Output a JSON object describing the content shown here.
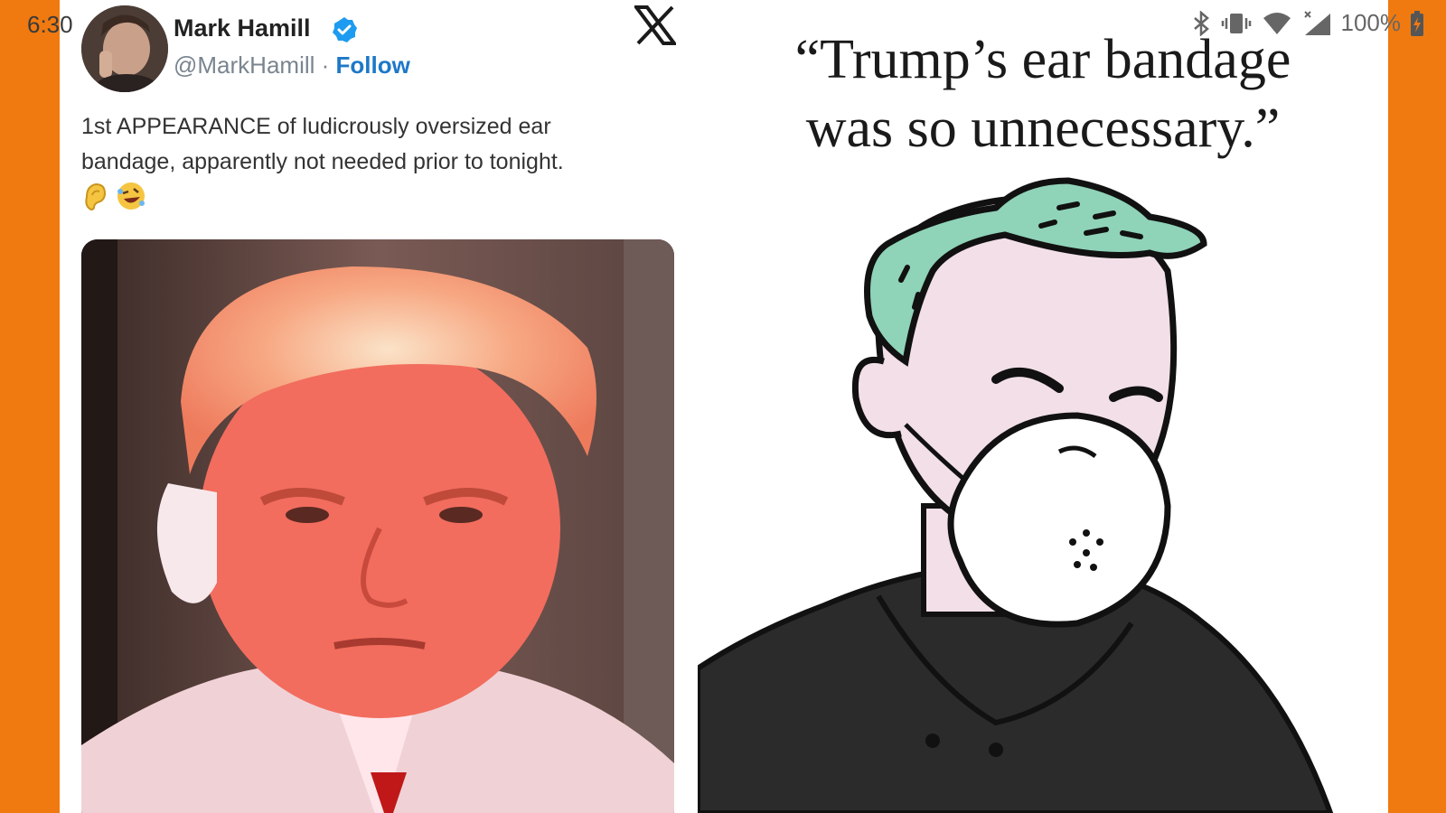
{
  "status_bar": {
    "time": "6:30",
    "battery": "100%",
    "icons": [
      "bluetooth-icon",
      "vibrate-icon",
      "wifi-icon",
      "signal-icon",
      "battery-charging-icon"
    ]
  },
  "tweet": {
    "author_name": "Mark Hamill",
    "handle": "@MarkHamill",
    "separator": "·",
    "follow_label": "Follow",
    "text_line1": "1st APPEARANCE of ludicrously oversized ear",
    "text_line2": "bandage, apparently not needed prior to tonight.",
    "emoji_ear": "👂",
    "emoji_laugh": "🤣",
    "platform_icon": "x-logo-icon"
  },
  "cartoon": {
    "quote_line1": "“Trump’s ear bandage",
    "quote_line2": "was so unnecessary.”"
  },
  "colors": {
    "background": "#f07a10",
    "follow": "#1d78c8",
    "verified": "#1d9bf0",
    "hair": "#8fd3b8",
    "skin": "#f2dfe8"
  }
}
